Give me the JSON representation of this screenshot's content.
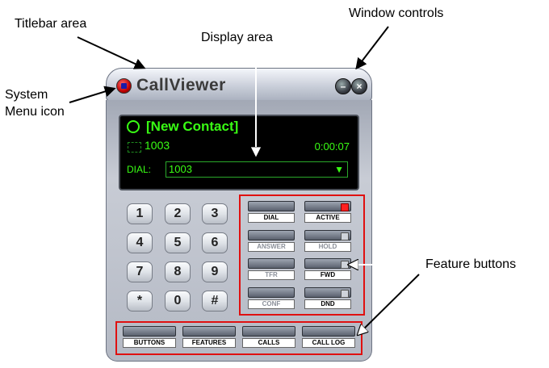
{
  "annotations": {
    "titlebar_area": "Titlebar area",
    "display_area": "Display area",
    "window_controls": "Window controls",
    "system_menu_line1": "System",
    "system_menu_line2": "Menu icon",
    "feature_buttons": "Feature buttons"
  },
  "window": {
    "title": "CallViewer",
    "minimize_glyph": "–",
    "close_glyph": "×"
  },
  "display": {
    "contact": "[New Contact]",
    "line_number": "1003",
    "timer": "0:00:07",
    "dial_label": "DIAL:",
    "dial_value": "1003",
    "dropdown_glyph": "▼"
  },
  "keypad": [
    "1",
    "2",
    "3",
    "4",
    "5",
    "6",
    "7",
    "8",
    "9",
    "*",
    "0",
    "#"
  ],
  "features": {
    "dial": "DIAL",
    "active": "ACTIVE",
    "answer": "ANSWER",
    "hold": "HOLD",
    "tfr": "TFR",
    "fwd": "FWD",
    "conf": "CONF",
    "dnd": "DND"
  },
  "bottom": {
    "buttons": "BUTTONS",
    "features": "FEATURES",
    "calls": "CALLS",
    "call_log": "CALL LOG"
  },
  "colors": {
    "display_text": "#39ff14",
    "highlight_outline": "#e01010",
    "active_led": "#ff2020"
  }
}
